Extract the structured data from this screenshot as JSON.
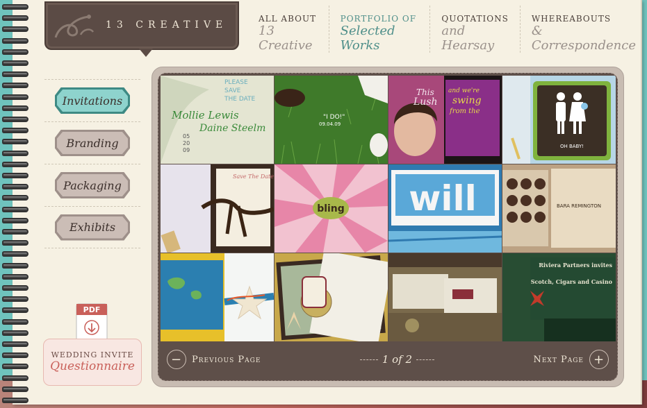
{
  "logo": {
    "text": "13 CREATIVE"
  },
  "nav": [
    {
      "small": "ALL ABOUT",
      "big": "13 Creative"
    },
    {
      "small": "PORTFOLIO OF",
      "big": "Selected Works"
    },
    {
      "small": "QUOTATIONS",
      "big": "and Hearsay"
    },
    {
      "small": "WHEREABOUTS",
      "big": "& Correspondence"
    }
  ],
  "sidebar": {
    "items": [
      {
        "label": "Invitations"
      },
      {
        "label": "Branding"
      },
      {
        "label": "Packaging"
      },
      {
        "label": "Exhibits"
      }
    ]
  },
  "pdf": {
    "label": "PDF"
  },
  "questionnaire": {
    "small": "WEDDING INVITE",
    "big": "Questionnaire"
  },
  "gallery": {
    "tile_texts": {
      "t1_a": "PLEASE",
      "t1_b": "SAVE",
      "t1_c": "THE DATE",
      "t1_names": "Mollie Lewis",
      "t1_names2": "Daine Steelm",
      "t2_text": "\"I DO!\"",
      "t3_a": "This",
      "t3_b": "Lush",
      "t4_text": "OH BABY!",
      "t6_text": "bling",
      "t7_text": "will",
      "t8_text": "BARA REMINGTON",
      "t12_a": "Riviera Partners invites",
      "t12_b": "Scotch, Cigars and Casino"
    }
  },
  "pager": {
    "prev": "Previous Page",
    "next": "Next Page",
    "count": "1 of 2"
  }
}
